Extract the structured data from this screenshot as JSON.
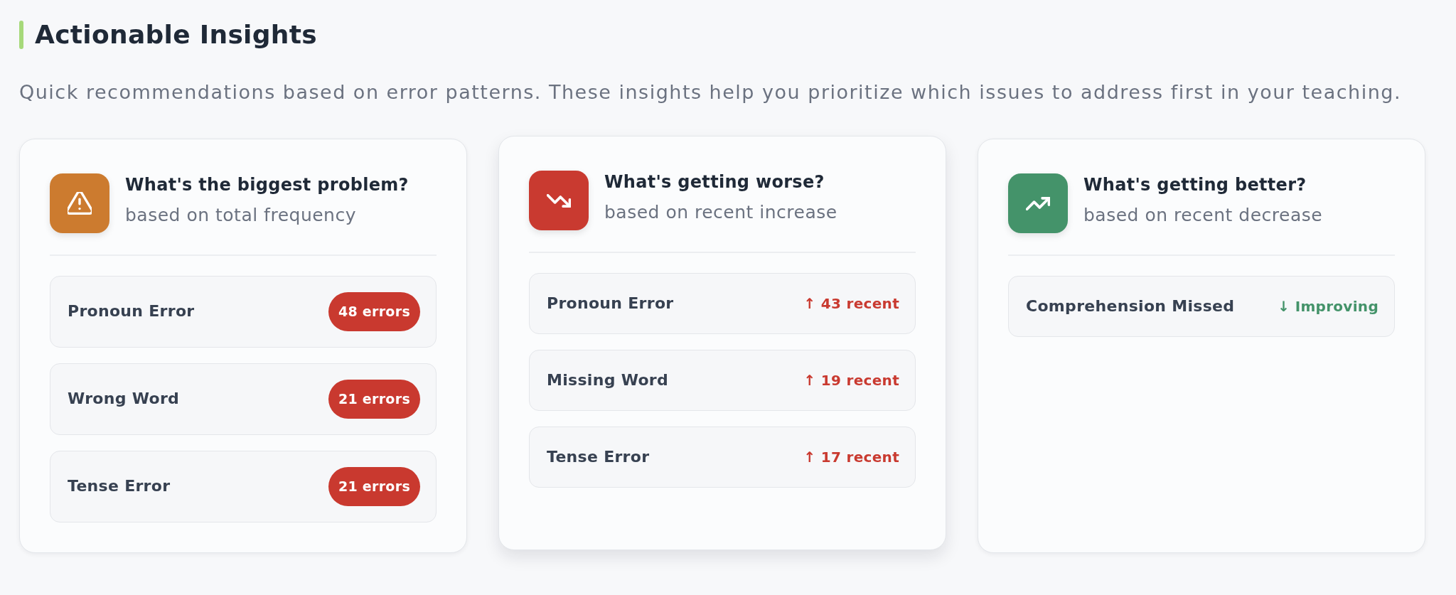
{
  "section": {
    "title": "Actionable Insights",
    "description": "Quick recommendations based on error patterns. These insights help you prioritize which issues to address first in your teaching."
  },
  "cards": [
    {
      "kind": "frequency",
      "color": "#cc7b2f",
      "hovered": false,
      "title": "What's the biggest problem?",
      "subtitle": "based on total frequency",
      "items": [
        {
          "label": "Pronoun Error",
          "value": "48 errors"
        },
        {
          "label": "Wrong Word",
          "value": "21 errors"
        },
        {
          "label": "Tense Error",
          "value": "21 errors"
        }
      ]
    },
    {
      "kind": "increase",
      "color": "#c93a30",
      "hovered": true,
      "title": "What's getting worse?",
      "subtitle": "based on recent increase",
      "items": [
        {
          "label": "Pronoun Error",
          "value": "↑ 43 recent"
        },
        {
          "label": "Missing Word",
          "value": "↑ 19 recent"
        },
        {
          "label": "Tense Error",
          "value": "↑ 17 recent"
        }
      ]
    },
    {
      "kind": "decrease",
      "color": "#44936a",
      "hovered": false,
      "title": "What's getting better?",
      "subtitle": "based on recent decrease",
      "items": [
        {
          "label": "Comprehension Missed",
          "value": "↓ Improving"
        }
      ]
    }
  ]
}
